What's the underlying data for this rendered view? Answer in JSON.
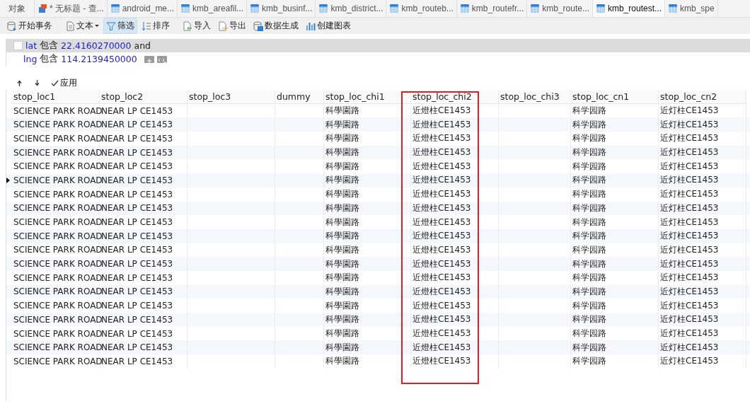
{
  "tabs": [
    {
      "label": "对象",
      "kind": "objects",
      "selected": false
    },
    {
      "label": "* 无标题 - 查...",
      "kind": "query",
      "selected": false
    },
    {
      "label": "android_me...",
      "kind": "table",
      "selected": false
    },
    {
      "label": "kmb_areafil...",
      "kind": "table",
      "selected": false
    },
    {
      "label": "kmb_businf...",
      "kind": "table",
      "selected": false
    },
    {
      "label": "kmb_district...",
      "kind": "table",
      "selected": false
    },
    {
      "label": "kmb_routeb...",
      "kind": "table",
      "selected": false
    },
    {
      "label": "kmb_routefr...",
      "kind": "table",
      "selected": false
    },
    {
      "label": "kmb_route...",
      "kind": "table",
      "selected": false
    },
    {
      "label": "kmb_routest...",
      "kind": "table",
      "selected": true
    },
    {
      "label": "kmb_spe",
      "kind": "table",
      "selected": false
    }
  ],
  "toolbar": [
    {
      "label": "开始事务",
      "kind": "transaction",
      "selected": false
    },
    {
      "label": "文本",
      "kind": "text",
      "selected": false
    },
    {
      "label": "筛选",
      "kind": "filter",
      "selected": true
    },
    {
      "label": "排序",
      "kind": "sort",
      "selected": false
    },
    {
      "label": "导入",
      "kind": "import",
      "selected": false
    },
    {
      "label": "导出",
      "kind": "export",
      "selected": false
    },
    {
      "label": "数据生成",
      "kind": "generate",
      "selected": false
    },
    {
      "label": "创建图表",
      "kind": "chart",
      "selected": false
    }
  ],
  "filter": {
    "conditions": [
      {
        "field": "lat",
        "operator": "包含",
        "value": "22.4160270000",
        "joiner": "and",
        "checked": false,
        "selected": true
      },
      {
        "field": "lng",
        "operator": "包含",
        "value": "114.2139450000",
        "selected": false
      }
    ],
    "apply_label": "应用"
  },
  "table": {
    "columns": [
      {
        "label": "stop_loc1",
        "highlighted": false
      },
      {
        "label": "stop_loc2",
        "highlighted": false
      },
      {
        "label": "stop_loc3",
        "highlighted": false
      },
      {
        "label": "dummy",
        "highlighted": false
      },
      {
        "label": "stop_loc_chi1",
        "highlighted": false
      },
      {
        "label": "stop_loc_chi2",
        "highlighted": true
      },
      {
        "label": "stop_loc_chi3",
        "highlighted": false
      },
      {
        "label": "stop_loc_cn1",
        "highlighted": false
      },
      {
        "label": "stop_loc_cn2",
        "highlighted": false
      }
    ],
    "rows": [
      {
        "current": false,
        "cells": [
          "SCIENCE PARK ROAD",
          "NEAR LP CE1453",
          "",
          "",
          "科學園路",
          "近燈柱CE1453",
          "",
          "科学园路",
          "近灯柱CE1453"
        ]
      },
      {
        "current": false,
        "cells": [
          "SCIENCE PARK ROAD",
          "NEAR LP CE1453",
          "",
          "",
          "科學園路",
          "近燈柱CE1453",
          "",
          "科学园路",
          "近灯柱CE1453"
        ]
      },
      {
        "current": false,
        "cells": [
          "SCIENCE PARK ROAD",
          "NEAR LP CE1453",
          "",
          "",
          "科學園路",
          "近燈柱CE1453",
          "",
          "科学园路",
          "近灯柱CE1453"
        ]
      },
      {
        "current": false,
        "cells": [
          "SCIENCE PARK ROAD",
          "NEAR LP CE1453",
          "",
          "",
          "科學園路",
          "近燈柱CE1453",
          "",
          "科学园路",
          "近灯柱CE1453"
        ]
      },
      {
        "current": false,
        "cells": [
          "SCIENCE PARK ROAD",
          "NEAR LP CE1453",
          "",
          "",
          "科學園路",
          "近燈柱CE1453",
          "",
          "科学园路",
          "近灯柱CE1453"
        ]
      },
      {
        "current": true,
        "cells": [
          "SCIENCE PARK ROAD",
          "NEAR LP CE1453",
          "",
          "",
          "科學園路",
          "近燈柱CE1453",
          "",
          "科学园路",
          "近灯柱CE1453"
        ]
      },
      {
        "current": false,
        "cells": [
          "SCIENCE PARK ROAD",
          "NEAR LP CE1453",
          "",
          "",
          "科學園路",
          "近燈柱CE1453",
          "",
          "科学园路",
          "近灯柱CE1453"
        ]
      },
      {
        "current": false,
        "cells": [
          "SCIENCE PARK ROAD",
          "NEAR LP CE1453",
          "",
          "",
          "科學園路",
          "近燈柱CE1453",
          "",
          "科学园路",
          "近灯柱CE1453"
        ]
      },
      {
        "current": false,
        "cells": [
          "SCIENCE PARK ROAD",
          "NEAR LP CE1453",
          "",
          "",
          "科學園路",
          "近燈柱CE1453",
          "",
          "科学园路",
          "近灯柱CE1453"
        ]
      },
      {
        "current": false,
        "cells": [
          "SCIENCE PARK ROAD",
          "NEAR LP CE1453",
          "",
          "",
          "科學園路",
          "近燈柱CE1453",
          "",
          "科学园路",
          "近灯柱CE1453"
        ]
      },
      {
        "current": false,
        "cells": [
          "SCIENCE PARK ROAD",
          "NEAR LP CE1453",
          "",
          "",
          "科學園路",
          "近燈柱CE1453",
          "",
          "科学园路",
          "近灯柱CE1453"
        ]
      },
      {
        "current": false,
        "cells": [
          "SCIENCE PARK ROAD",
          "NEAR LP CE1453",
          "",
          "",
          "科學園路",
          "近燈柱CE1453",
          "",
          "科学园路",
          "近灯柱CE1453"
        ]
      },
      {
        "current": false,
        "cells": [
          "SCIENCE PARK ROAD",
          "NEAR LP CE1453",
          "",
          "",
          "科學園路",
          "近燈柱CE1453",
          "",
          "科学园路",
          "近灯柱CE1453"
        ]
      },
      {
        "current": false,
        "cells": [
          "SCIENCE PARK ROAD",
          "NEAR LP CE1453",
          "",
          "",
          "科學園路",
          "近燈柱CE1453",
          "",
          "科学园路",
          "近灯柱CE1453"
        ]
      },
      {
        "current": false,
        "cells": [
          "SCIENCE PARK ROAD",
          "NEAR LP CE1453",
          "",
          "",
          "科學園路",
          "近燈柱CE1453",
          "",
          "科学园路",
          "近灯柱CE1453"
        ]
      },
      {
        "current": false,
        "cells": [
          "SCIENCE PARK ROAD",
          "NEAR LP CE1453",
          "",
          "",
          "科學園路",
          "近燈柱CE1453",
          "",
          "科学园路",
          "近灯柱CE1453"
        ]
      },
      {
        "current": false,
        "cells": [
          "SCIENCE PARK ROAD",
          "NEAR LP CE1453",
          "",
          "",
          "科學園路",
          "近燈柱CE1453",
          "",
          "科学园路",
          "近灯柱CE1453"
        ]
      },
      {
        "current": false,
        "cells": [
          "SCIENCE PARK ROAD",
          "NEAR LP CE1453",
          "",
          "",
          "科學園路",
          "近燈柱CE1453",
          "",
          "科学园路",
          "近灯柱CE1453"
        ]
      },
      {
        "current": false,
        "cells": [
          "SCIENCE PARK ROAD",
          "NEAR LP CE1453",
          "",
          "",
          "科學園路",
          "近燈柱CE1453",
          "",
          "科学园路",
          "近灯柱CE1453"
        ]
      }
    ]
  }
}
